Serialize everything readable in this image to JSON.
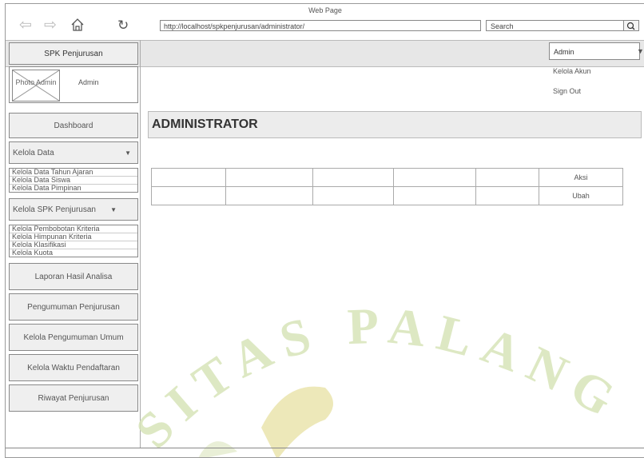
{
  "browser": {
    "window_title": "Web Page",
    "url": "http://localhost/spkpenjurusan/administrator/",
    "search_placeholder": "Search"
  },
  "sidebar": {
    "brand": "SPK Penjurusan",
    "profile": {
      "photo_label": "Photo Admin",
      "name": "Admin"
    },
    "dashboard": "Dashboard",
    "kelola_data": {
      "label": "Kelola Data",
      "items": [
        "Kelola Data Tahun Ajaran",
        "Kelola Data Siswa",
        "Kelola Data Pimpinan"
      ]
    },
    "kelola_spk": {
      "label": "Kelola SPK Penjurusan",
      "items": [
        "Kelola Pembobotan Kriteria",
        "Kelola Himpunan Kriteria",
        "Kelola Klasifikasi",
        "Kelola Kuota"
      ]
    },
    "buttons": [
      "Laporan Hasil Analisa",
      "Pengumuman Penjurusan",
      "Kelola Pengumuman Umum",
      "Kelola Waktu Pendaftaran",
      "Riwayat Penjurusan"
    ]
  },
  "account_menu": {
    "label": "Admin",
    "items": [
      "Kelola Akun",
      "Sign Out"
    ]
  },
  "main": {
    "title": "ADMINISTRATOR",
    "table": {
      "action_header": "Aksi",
      "row_action": "Ubah"
    }
  },
  "watermark": {
    "text": "UNIVERSITAS PALANGKA RAYA",
    "visible_text": "SITAS PALANGK"
  }
}
